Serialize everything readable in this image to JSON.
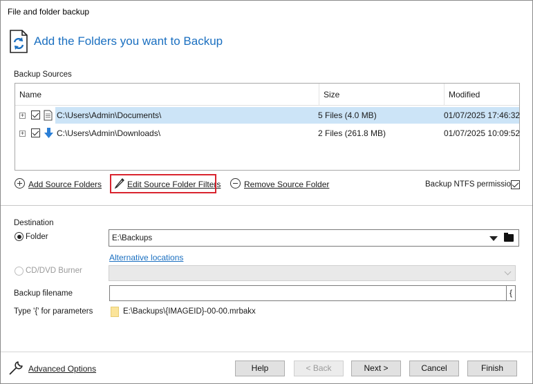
{
  "window": {
    "title": "File and folder backup"
  },
  "header": {
    "title": "Add the Folders you want to Backup"
  },
  "sources": {
    "label": "Backup Sources",
    "columns": [
      "Name",
      "Size",
      "Modified"
    ],
    "rows": [
      {
        "name": "C:\\Users\\Admin\\Documents\\",
        "size": "5 Files (4.0 MB)",
        "modified": "01/07/2025 17:46:32",
        "icon": "document-icon"
      },
      {
        "name": "C:\\Users\\Admin\\Downloads\\",
        "size": "2 Files (261.8 MB)",
        "modified": "01/07/2025 10:09:52",
        "icon": "download-arrow-icon"
      }
    ],
    "expander": "+",
    "add_label": "Add Source Folders",
    "edit_label": "Edit Source Folder Filters",
    "remove_label": "Remove Source Folder",
    "ntfs_label": "Backup NTFS permissions"
  },
  "destination": {
    "label": "Destination",
    "folder_label": "Folder",
    "folder_value": "E:\\Backups",
    "alt_locations": "Alternative locations",
    "cd_label": "CD/DVD Burner",
    "filename_label": "Backup filename",
    "filename_value": "",
    "brace_button": "{",
    "param_hint": "Type '{' for parameters",
    "path_preview": "E:\\Backups\\{IMAGEID}-00-00.mrbakx"
  },
  "footer": {
    "advanced": "Advanced Options",
    "help": "Help",
    "back": "< Back",
    "next": "Next >",
    "cancel": "Cancel",
    "finish": "Finish"
  },
  "colors": {
    "accent": "#1a6fc0",
    "selection": "#cce4f7",
    "highlight_box": "#d9232e"
  }
}
